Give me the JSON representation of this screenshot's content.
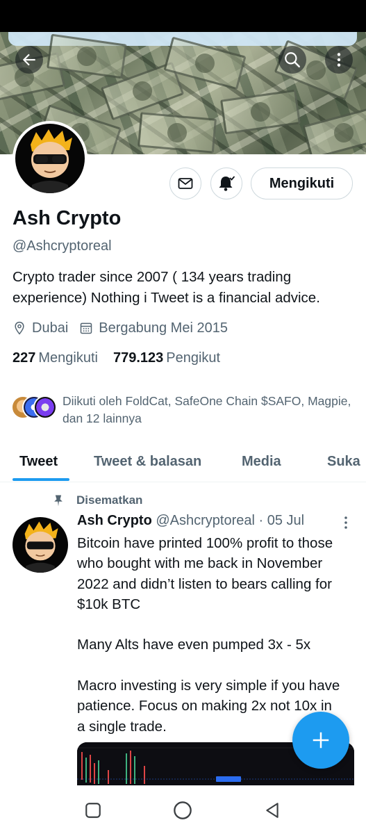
{
  "profile": {
    "name": "Ash Crypto",
    "handle": "@Ashcryptoreal",
    "bio": "Crypto trader since 2007 ( 134 years trading experience) Nothing i Tweet is a financial advice.",
    "location": "Dubai",
    "joined": "Bergabung Mei 2015",
    "following_count": "227",
    "following_label": "Mengikuti",
    "followers_count": "779.123",
    "followers_label": "Pengikut",
    "follow_button_label": "Mengikuti",
    "followed_by_text": "Diikuti oleh FoldCat, SafeOne Chain $SAFO, Magpie, dan 12 lainnya"
  },
  "header": {
    "back_icon": "arrow-left-icon",
    "search_icon": "search-icon",
    "more_icon": "more-vertical-icon"
  },
  "actions": {
    "message_icon": "envelope-icon",
    "notify_icon": "bell-check-icon"
  },
  "tabs": [
    {
      "label": "Tweet",
      "active": true
    },
    {
      "label": "Tweet & balasan",
      "active": false
    },
    {
      "label": "Media",
      "active": false
    },
    {
      "label": "Suka",
      "active": false
    }
  ],
  "pinned_tweet": {
    "pinned_label": "Disematkan",
    "author_name": "Ash Crypto",
    "author_handle": "@Ashcryptoreal",
    "separator": "·",
    "date": "05 Jul",
    "text": "Bitcoin have printed 100% profit to those who bought with me back in November 2022 and didn’t listen to bears calling for $10k BTC\n\nMany Alts have even pumped 3x - 5x\n\nMacro investing is very simple if you have patience. Focus on making 2x not 10x in a single trade."
  },
  "fab": {
    "icon": "plus-icon"
  },
  "nav": {
    "items": [
      "recent-apps-icon",
      "home-icon",
      "back-icon"
    ]
  },
  "colors": {
    "accent": "#1d9bf0",
    "text_primary": "#0f1419",
    "text_secondary": "#536471",
    "border": "#cfd9de"
  }
}
